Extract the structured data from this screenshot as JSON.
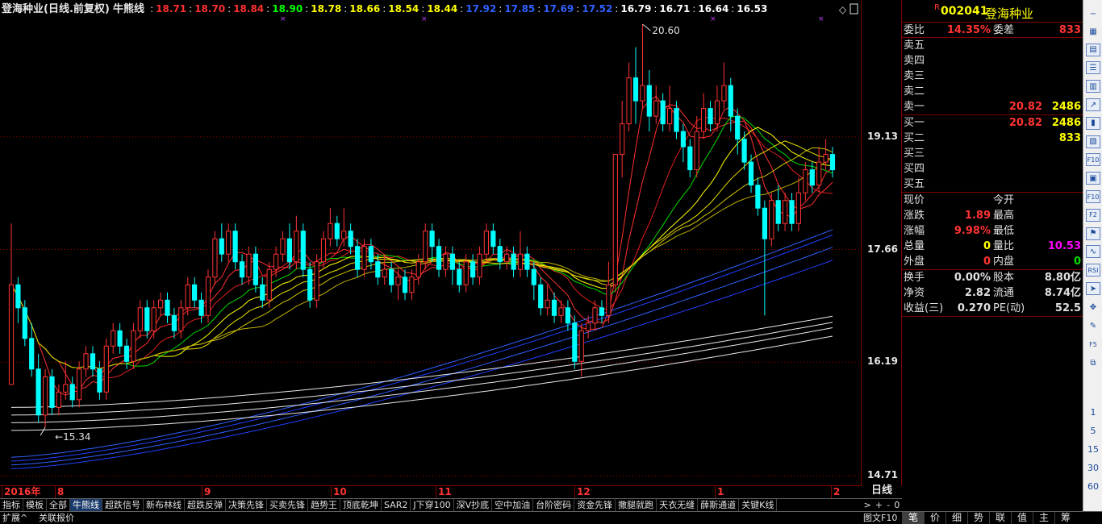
{
  "chart_title": {
    "stock_name": "登海种业(日线.前复权)",
    "indicator": "牛熊线",
    "ma_values": [
      {
        "v": "18.71",
        "color": "#ff3030"
      },
      {
        "v": "18.70",
        "color": "#ff3030"
      },
      {
        "v": "18.84",
        "color": "#ff3030"
      },
      {
        "v": "18.90",
        "color": "#00ff00"
      },
      {
        "v": "18.78",
        "color": "#ffff00"
      },
      {
        "v": "18.66",
        "color": "#ffff00"
      },
      {
        "v": "18.54",
        "color": "#ffff00"
      },
      {
        "v": "18.44",
        "color": "#ffff00"
      },
      {
        "v": "17.92",
        "color": "#3060ff"
      },
      {
        "v": "17.85",
        "color": "#3060ff"
      },
      {
        "v": "17.69",
        "color": "#3060ff"
      },
      {
        "v": "17.52",
        "color": "#3060ff"
      },
      {
        "v": "16.79",
        "color": "#ffffff"
      },
      {
        "v": "16.71",
        "color": "#ffffff"
      },
      {
        "v": "16.64",
        "color": "#ffffff"
      },
      {
        "v": "16.53",
        "color": "#ffffff"
      }
    ]
  },
  "chart_data": {
    "type": "candlestick",
    "y_axis_ticks": [
      19.13,
      17.66,
      16.19,
      14.71
    ],
    "ylim": [
      14.71,
      20.6
    ],
    "x_month_labels": [
      "2016年",
      "8",
      "9",
      "10",
      "11",
      "12",
      "1",
      "2"
    ],
    "annotations": {
      "high": "20.60",
      "low": "15.34"
    },
    "candles": [
      [
        15.9,
        17.2,
        18.0,
        15.9
      ],
      [
        17.2,
        16.9,
        17.3,
        16.7
      ],
      [
        16.9,
        16.5,
        17.0,
        16.4
      ],
      [
        16.5,
        16.1,
        16.7,
        16.0
      ],
      [
        16.1,
        15.5,
        16.3,
        15.4
      ],
      [
        15.5,
        16.0,
        16.1,
        15.34
      ],
      [
        16.0,
        15.6,
        16.1,
        15.5
      ],
      [
        15.6,
        15.8,
        15.9,
        15.5
      ],
      [
        15.8,
        15.9,
        16.2,
        15.7
      ],
      [
        15.9,
        15.7,
        16.0,
        15.6
      ],
      [
        15.7,
        16.1,
        16.2,
        15.6
      ],
      [
        16.1,
        16.3,
        16.4,
        16.0
      ],
      [
        16.3,
        16.1,
        16.4,
        16.0
      ],
      [
        16.1,
        15.8,
        16.2,
        15.7
      ],
      [
        15.8,
        16.4,
        16.5,
        15.7
      ],
      [
        16.4,
        16.6,
        16.7,
        16.3
      ],
      [
        16.6,
        16.4,
        16.7,
        16.3
      ],
      [
        16.4,
        16.2,
        16.5,
        16.1
      ],
      [
        16.2,
        16.6,
        16.7,
        16.1
      ],
      [
        16.6,
        16.9,
        17.0,
        16.5
      ],
      [
        16.9,
        16.6,
        17.0,
        16.5
      ],
      [
        16.6,
        16.9,
        17.0,
        16.5
      ],
      [
        16.9,
        17.0,
        17.1,
        16.8
      ],
      [
        17.0,
        16.8,
        17.1,
        16.7
      ],
      [
        16.8,
        16.6,
        16.9,
        16.5
      ],
      [
        16.6,
        16.9,
        17.0,
        16.5
      ],
      [
        16.9,
        17.2,
        17.3,
        16.8
      ],
      [
        17.2,
        17.0,
        17.3,
        16.9
      ],
      [
        17.0,
        16.8,
        17.1,
        16.7
      ],
      [
        16.8,
        17.3,
        17.4,
        16.7
      ],
      [
        17.3,
        17.8,
        17.9,
        17.2
      ],
      [
        17.8,
        17.6,
        18.0,
        17.5
      ],
      [
        17.6,
        17.9,
        18.0,
        17.5
      ],
      [
        17.9,
        17.5,
        18.0,
        17.4
      ],
      [
        17.5,
        17.3,
        17.6,
        17.2
      ],
      [
        17.3,
        17.6,
        17.7,
        17.2
      ],
      [
        17.6,
        17.2,
        17.7,
        17.1
      ],
      [
        17.2,
        17.0,
        17.3,
        16.9
      ],
      [
        17.0,
        17.4,
        17.5,
        16.9
      ],
      [
        17.4,
        17.6,
        17.7,
        17.3
      ],
      [
        17.6,
        17.8,
        17.9,
        17.5
      ],
      [
        17.8,
        17.5,
        18.0,
        17.4
      ],
      [
        17.5,
        17.9,
        18.1,
        17.4
      ],
      [
        17.9,
        17.4,
        18.0,
        17.3
      ],
      [
        17.4,
        17.0,
        17.5,
        16.9
      ],
      [
        17.0,
        17.5,
        17.6,
        16.9
      ],
      [
        17.5,
        17.8,
        17.9,
        17.4
      ],
      [
        17.8,
        18.0,
        18.2,
        17.7
      ],
      [
        18.0,
        17.8,
        18.1,
        17.7
      ],
      [
        17.8,
        17.9,
        18.2,
        17.7
      ],
      [
        17.9,
        17.7,
        18.0,
        17.6
      ],
      [
        17.7,
        17.4,
        17.8,
        17.3
      ],
      [
        17.4,
        17.7,
        17.8,
        17.3
      ],
      [
        17.7,
        17.5,
        17.8,
        17.4
      ],
      [
        17.5,
        17.3,
        17.6,
        17.2
      ],
      [
        17.3,
        17.4,
        17.6,
        17.2
      ],
      [
        17.4,
        17.2,
        17.5,
        17.1
      ],
      [
        17.2,
        17.3,
        17.4,
        17.0
      ],
      [
        17.3,
        17.1,
        17.4,
        17.0
      ],
      [
        17.1,
        17.3,
        17.4,
        17.0
      ],
      [
        17.3,
        17.5,
        17.6,
        17.2
      ],
      [
        17.5,
        17.9,
        18.0,
        17.4
      ],
      [
        17.9,
        17.7,
        18.0,
        17.5
      ],
      [
        17.7,
        17.4,
        17.8,
        17.3
      ],
      [
        17.4,
        17.6,
        17.7,
        17.3
      ],
      [
        17.6,
        17.4,
        17.7,
        17.2
      ],
      [
        17.4,
        17.2,
        17.5,
        17.1
      ],
      [
        17.2,
        17.5,
        17.6,
        17.1
      ],
      [
        17.5,
        17.3,
        17.6,
        17.2
      ],
      [
        17.3,
        17.6,
        17.7,
        17.2
      ],
      [
        17.6,
        17.9,
        18.0,
        17.5
      ],
      [
        17.9,
        17.7,
        18.0,
        17.6
      ],
      [
        17.7,
        17.5,
        17.8,
        17.4
      ],
      [
        17.5,
        17.6,
        17.7,
        17.4
      ],
      [
        17.6,
        17.4,
        17.7,
        17.3
      ],
      [
        17.4,
        17.6,
        17.9,
        17.3
      ],
      [
        17.6,
        17.4,
        17.7,
        17.3
      ],
      [
        17.4,
        17.2,
        17.5,
        17.0
      ],
      [
        17.2,
        16.9,
        17.3,
        16.8
      ],
      [
        16.9,
        17.0,
        17.2,
        16.8
      ],
      [
        17.0,
        16.8,
        17.1,
        16.7
      ],
      [
        16.8,
        16.9,
        17.0,
        16.7
      ],
      [
        16.9,
        16.7,
        17.0,
        16.6
      ],
      [
        16.7,
        16.2,
        16.8,
        16.1
      ],
      [
        16.2,
        16.6,
        16.7,
        16.0
      ],
      [
        16.6,
        16.7,
        16.8,
        16.5
      ],
      [
        16.7,
        16.9,
        17.0,
        16.6
      ],
      [
        16.9,
        16.8,
        17.0,
        16.7
      ],
      [
        16.8,
        17.2,
        17.5,
        16.7
      ],
      [
        17.2,
        18.9,
        18.9,
        17.1
      ],
      [
        18.9,
        19.3,
        19.6,
        18.6
      ],
      [
        19.3,
        19.9,
        20.1,
        19.2
      ],
      [
        19.9,
        19.6,
        20.3,
        19.3
      ],
      [
        19.6,
        19.8,
        20.6,
        19.5
      ],
      [
        19.8,
        19.4,
        20.0,
        19.2
      ],
      [
        19.4,
        19.6,
        19.8,
        19.3
      ],
      [
        19.6,
        19.3,
        19.7,
        19.2
      ],
      [
        19.3,
        19.5,
        19.8,
        19.2
      ],
      [
        19.5,
        19.2,
        19.6,
        19.1
      ],
      [
        19.2,
        19.0,
        19.3,
        18.8
      ],
      [
        19.0,
        18.7,
        19.1,
        18.6
      ],
      [
        18.7,
        19.2,
        19.4,
        18.6
      ],
      [
        19.2,
        19.5,
        19.7,
        19.1
      ],
      [
        19.5,
        19.3,
        19.6,
        19.2
      ],
      [
        19.3,
        19.6,
        19.8,
        19.2
      ],
      [
        19.6,
        19.8,
        20.1,
        19.5
      ],
      [
        19.8,
        19.4,
        19.9,
        19.2
      ],
      [
        19.4,
        19.1,
        19.5,
        18.9
      ],
      [
        19.1,
        18.8,
        19.2,
        18.7
      ],
      [
        18.8,
        18.5,
        18.9,
        18.4
      ],
      [
        18.5,
        18.2,
        18.6,
        18.1
      ],
      [
        18.2,
        17.8,
        18.3,
        16.8
      ],
      [
        17.8,
        18.3,
        18.4,
        17.7
      ],
      [
        18.3,
        18.0,
        18.5,
        17.9
      ],
      [
        18.0,
        18.3,
        18.4,
        17.9
      ],
      [
        18.3,
        18.0,
        18.4,
        17.9
      ],
      [
        18.0,
        18.4,
        18.6,
        17.9
      ],
      [
        18.4,
        18.7,
        18.8,
        18.3
      ],
      [
        18.7,
        18.5,
        18.8,
        18.4
      ],
      [
        18.5,
        18.8,
        19.0,
        18.4
      ],
      [
        18.8,
        18.9,
        19.1,
        18.7
      ],
      [
        18.9,
        18.7,
        19.0,
        18.6
      ]
    ]
  },
  "date_axis": [
    {
      "label": "2016年",
      "red": true
    },
    {
      "label": "8",
      "red": true
    },
    {
      "label": "9",
      "red": true
    },
    {
      "label": "10",
      "red": true
    },
    {
      "label": "11",
      "red": true
    },
    {
      "label": "12",
      "red": true
    },
    {
      "label": "1",
      "red": true
    },
    {
      "label": "2",
      "red": true
    }
  ],
  "period": "日线",
  "indicator_tabs": [
    "指标",
    "模板",
    "全部",
    "牛熊线",
    "超跌信号",
    "新布林线",
    "超跌反弹",
    "决策先锋",
    "买卖先锋",
    "趋势王",
    "顶底乾坤",
    "SAR2",
    "J下穿100",
    "深V抄底",
    "空中加油",
    "台阶密码",
    "资金先锋",
    "撒腿就跑",
    "天衣无缝",
    "薛斯通道",
    "关键K线"
  ],
  "tab_controls": [
    ">",
    "+",
    "-",
    "0"
  ],
  "bottom_bar": {
    "expand": "扩展^",
    "related": "关联报价",
    "chart_f10": "图文F10"
  },
  "bottom_tabs": [
    "笔",
    "价",
    "细",
    "势",
    "联",
    "值",
    "主",
    "筹"
  ],
  "quote": {
    "flag": "R",
    "code": "002041",
    "name": "登海种业",
    "weibi_label": "委比",
    "weibi": "14.35%",
    "weicha_label": "委差",
    "weicha": "833",
    "sells": [
      {
        "label": "卖五",
        "price": "",
        "vol": ""
      },
      {
        "label": "卖四",
        "price": "",
        "vol": ""
      },
      {
        "label": "卖三",
        "price": "",
        "vol": ""
      },
      {
        "label": "卖二",
        "price": "",
        "vol": ""
      },
      {
        "label": "卖一",
        "price": "20.82",
        "vol": "2486"
      }
    ],
    "buys": [
      {
        "label": "买一",
        "price": "20.82",
        "vol": "2486"
      },
      {
        "label": "买二",
        "price": "",
        "vol": "833"
      },
      {
        "label": "买三",
        "price": "",
        "vol": ""
      },
      {
        "label": "买四",
        "price": "",
        "vol": ""
      },
      {
        "label": "买五",
        "price": "",
        "vol": ""
      }
    ],
    "rows1": [
      {
        "l1": "现价",
        "v1": "",
        "c1": "white",
        "l2": "今开",
        "v2": "",
        "c2": "white"
      },
      {
        "l1": "涨跌",
        "v1": "1.89",
        "c1": "red",
        "l2": "最高",
        "v2": "",
        "c2": "white"
      },
      {
        "l1": "涨幅",
        "v1": "9.98%",
        "c1": "red",
        "l2": "最低",
        "v2": "",
        "c2": "white"
      },
      {
        "l1": "总量",
        "v1": "0",
        "c1": "yellow",
        "l2": "量比",
        "v2": "10.53",
        "c2": "magenta"
      },
      {
        "l1": "外盘",
        "v1": "0",
        "c1": "red",
        "l2": "内盘",
        "v2": "0",
        "c2": "green"
      }
    ],
    "rows2": [
      {
        "l1": "换手",
        "v1": "0.00%",
        "l2": "股本",
        "v2": "8.80亿"
      },
      {
        "l1": "净资",
        "v1": "2.82",
        "l2": "流通",
        "v2": "8.74亿"
      },
      {
        "l1": "收益(三)",
        "v1": "0.270",
        "l2": "PE(动)",
        "v2": "52.5"
      }
    ]
  },
  "toolbar": {
    "buttons": [
      "minus-icon",
      "grid-icon",
      "page-icon",
      "list-icon",
      "bars-icon",
      "trend-icon",
      "candle-icon",
      "bars2-icon",
      "f10-icon",
      "chart-icon",
      "f10b-icon",
      "f2-icon",
      "flag-icon",
      "wave-icon",
      "rsi-icon",
      "arrow-icon",
      "move-icon",
      "pen-icon",
      "f5-icon",
      "f6-icon"
    ],
    "numbers": [
      "1",
      "5",
      "15",
      "30",
      "60"
    ]
  },
  "colors": {
    "up": "#ff3333",
    "down": "#00ffff",
    "frame": "#800000"
  }
}
